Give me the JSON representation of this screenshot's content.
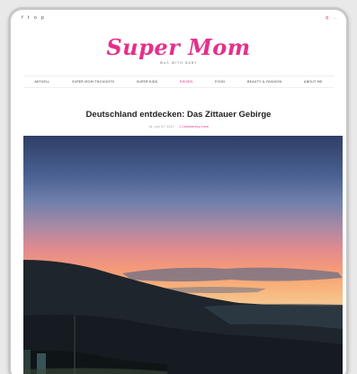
{
  "topbar": {
    "social_icons": [
      "f",
      "t",
      "o",
      "p"
    ],
    "search_icon": "q",
    "menu_icon": "..."
  },
  "brand": {
    "name": "Super Mom",
    "tagline": "WAS WITH BABY",
    "accent_color": "#e4308a"
  },
  "nav": {
    "items": [
      {
        "label": "AKTUELL"
      },
      {
        "label": "SUPER MOM THOUGHTS"
      },
      {
        "label": "SUPER KIDS"
      },
      {
        "label": "REISEN"
      },
      {
        "label": "FOOD"
      },
      {
        "label": "BEAUTY & FASHION"
      },
      {
        "label": "ABOUT ME"
      }
    ],
    "active_label": "REISEN"
  },
  "post": {
    "title": "Deutschland entdecken: Das Zittauer Gebirge",
    "date": "14. juni 07, 2017",
    "comments": "1 Comment(s) here"
  }
}
